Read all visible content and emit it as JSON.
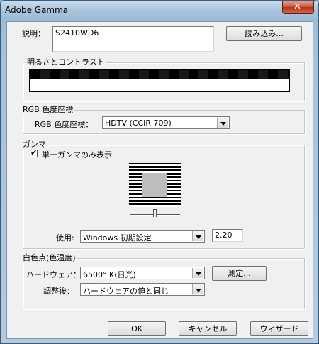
{
  "window": {
    "title": "Adobe Gamma"
  },
  "description": {
    "label": "説明：",
    "value": "S2410WD6",
    "load_button": "読み込み..."
  },
  "brightness": {
    "legend": "明るさとコントラスト"
  },
  "phosphors": {
    "legend": "RGB 色度座標",
    "label": "RGB 色度座標：",
    "selected": "HDTV (CCIR 709)"
  },
  "gamma": {
    "legend": "ガンマ",
    "single_gamma_label": "単一ガンマのみ表示",
    "single_gamma_checked": true,
    "slider_level": 0.5,
    "use_label": "使用:",
    "use_selected": "Windows 初期設定",
    "value": "2.20"
  },
  "white_point": {
    "legend": "白色点(色温度)",
    "hardware_label": "ハードウェア：",
    "hardware_selected": "6500° K(日光)",
    "measure_button": "測定...",
    "adjusted_label": "調整後：",
    "adjusted_selected": "ハードウェアの値と同じ"
  },
  "buttons": {
    "ok": "OK",
    "cancel": "キャンセル",
    "wizard": "ウィザード"
  },
  "icons": {
    "close": "close-icon",
    "check": "checkmark-icon",
    "dropdown": "chevron-down-icon"
  }
}
